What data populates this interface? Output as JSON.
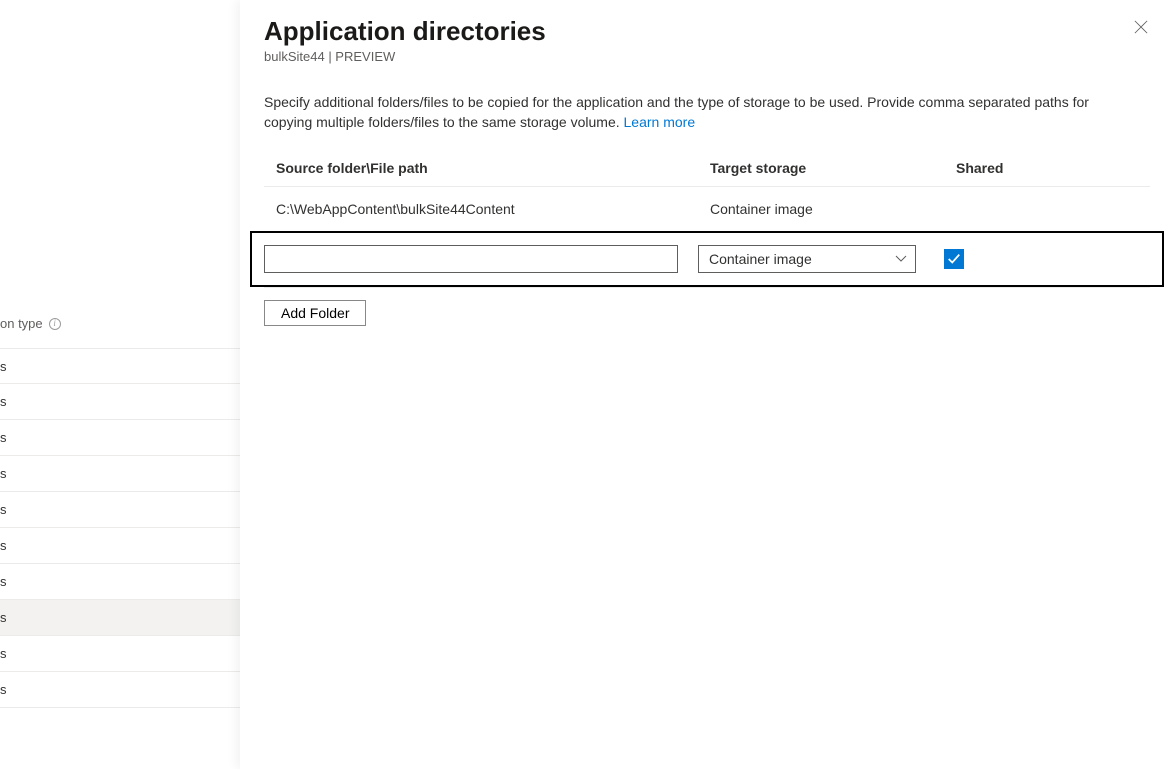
{
  "left": {
    "label_fragment": "on type",
    "items": [
      "s",
      "s",
      "s",
      "s",
      "s",
      "s",
      "s",
      "s",
      "s",
      "s"
    ],
    "selected_index": 7
  },
  "blade": {
    "title": "Application directories",
    "subtitle": "bulkSite44 | PREVIEW",
    "description": "Specify additional folders/files to be copied for the application and the type of storage to be used. Provide comma separated paths for copying multiple folders/files to the same storage volume. ",
    "learn_more": "Learn more"
  },
  "columns": {
    "source": "Source folder\\File path",
    "target": "Target storage",
    "shared": "Shared"
  },
  "rows": [
    {
      "source": "C:\\WebAppContent\\bulkSite44Content",
      "target": "Container image",
      "shared": false,
      "editing": false
    },
    {
      "source": "",
      "target": "Container image",
      "shared": true,
      "editing": true
    }
  ],
  "buttons": {
    "add_folder": "Add Folder"
  }
}
